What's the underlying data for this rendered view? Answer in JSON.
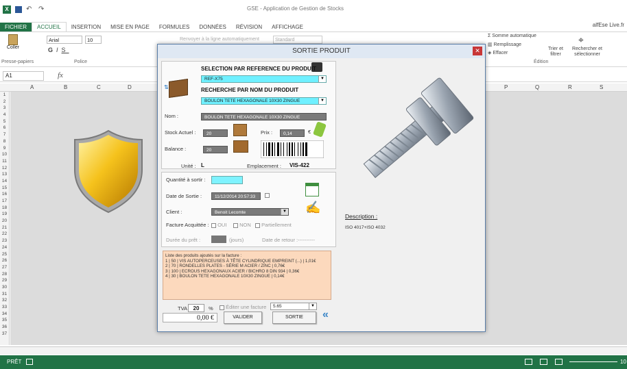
{
  "app": {
    "title": "GSE - Application de Gestion de Stocks",
    "user": "alfEse Live.fr"
  },
  "tabs": [
    "FICHIER",
    "ACCUEIL",
    "INSERTION",
    "MISE EN PAGE",
    "FORMULES",
    "DONNÉES",
    "RÉVISION",
    "AFFICHAGE"
  ],
  "ribbon": {
    "font_name": "Arial",
    "font_size": "10",
    "wrap_text": "Renvoyer à la ligne automatiquement",
    "number_format": "Standard",
    "paste": "Coller",
    "autosum": "Somme automatique",
    "fill": "Remplissage",
    "clear": "Effacer",
    "sort_filter": "Trier et filtrer",
    "find_select": "Rechercher et sélectionner",
    "groups": {
      "clipboard": "Presse-papiers",
      "font": "Police",
      "edit": "Édition"
    }
  },
  "namebox": "A1",
  "columns": [
    "A",
    "B",
    "C",
    "D",
    "P",
    "Q",
    "R",
    "S"
  ],
  "rows": [
    "1",
    "2",
    "3",
    "4",
    "5",
    "6",
    "7",
    "8",
    "9",
    "10",
    "11",
    "12",
    "13",
    "14",
    "15",
    "16",
    "17",
    "18",
    "19",
    "20",
    "21",
    "22",
    "23",
    "24",
    "25",
    "26",
    "27",
    "28",
    "29",
    "30",
    "31",
    "32",
    "33",
    "34",
    "35",
    "36",
    "37"
  ],
  "status": {
    "ready": "PRÊT",
    "zoom": "10"
  },
  "dialog": {
    "title": "SORTIE PRODUIT",
    "close": "✕",
    "sel_ref_label": "SELECTION PAR REFERENCE DU PRODUIT",
    "ref_value": "REF-X75",
    "search_name_label": "RECHERCHE PAR NOM DU PRODUIT",
    "name_search_value": "BOULON TETE HEXAGONALE 10X30 ZINGUE",
    "nom_label": "Nom :",
    "nom_value": "BOULON TETE HEXAGONALE 10X30 ZINGUE",
    "stock_label": "Stock Actuel :",
    "stock_value": "20",
    "prix_label": "Prix :",
    "prix_value": "0,14",
    "currency": "€",
    "balance_label": "Balance :",
    "balance_value": "20",
    "unite_label": "Unité :",
    "unite_value": "L",
    "emplacement_label": "Emplacement :",
    "emplacement_value": "VIS-422",
    "qty_label": "Quantité à sortir :",
    "date_label": "Date de Sortie :",
    "date_value": "11/12/2014 20:57:33",
    "client_label": "Client :",
    "client_value": "Benoit Lecomte",
    "facture_label": "Facture Acquittée :",
    "opt_oui": "OUI",
    "opt_non": "NON",
    "opt_part": "Partiellement",
    "duree_label": "Durée du prêt :",
    "duree_unit": "(jours)",
    "retour_label": "Date de retour :",
    "retour_value": "----------",
    "list_title": "Liste des produits ajoutés sur la facture :",
    "list_items": [
      "1 | 50 | VIS AUTOPERCEUSES À TÊTE CYLINDRIQUE EMPREINT (...) | 1,01€",
      "2 | 70 | RONDELLES PLATES - SÉRIE M ACIER / ZINC | 0,76€",
      "3 | 100 | ECROUS HEXAGONAUX ACIER / BICHRO 8 DIN 934 | 0,36€",
      "4 | 30 | BOULON TETE HEXAGONALE 10X30 ZINGUE | 0,14€"
    ],
    "tva_label": "TVA :",
    "tva_value": "20",
    "pct": "%",
    "editer_label": "Éditer une facture",
    "format_value": "5.65",
    "total_value": "0,00 €",
    "valider": "VALIDER",
    "sortie": "SORTIE",
    "collapse": "«",
    "description_label": "Description :",
    "description_value": "ISO 4017+ISO 4032"
  }
}
